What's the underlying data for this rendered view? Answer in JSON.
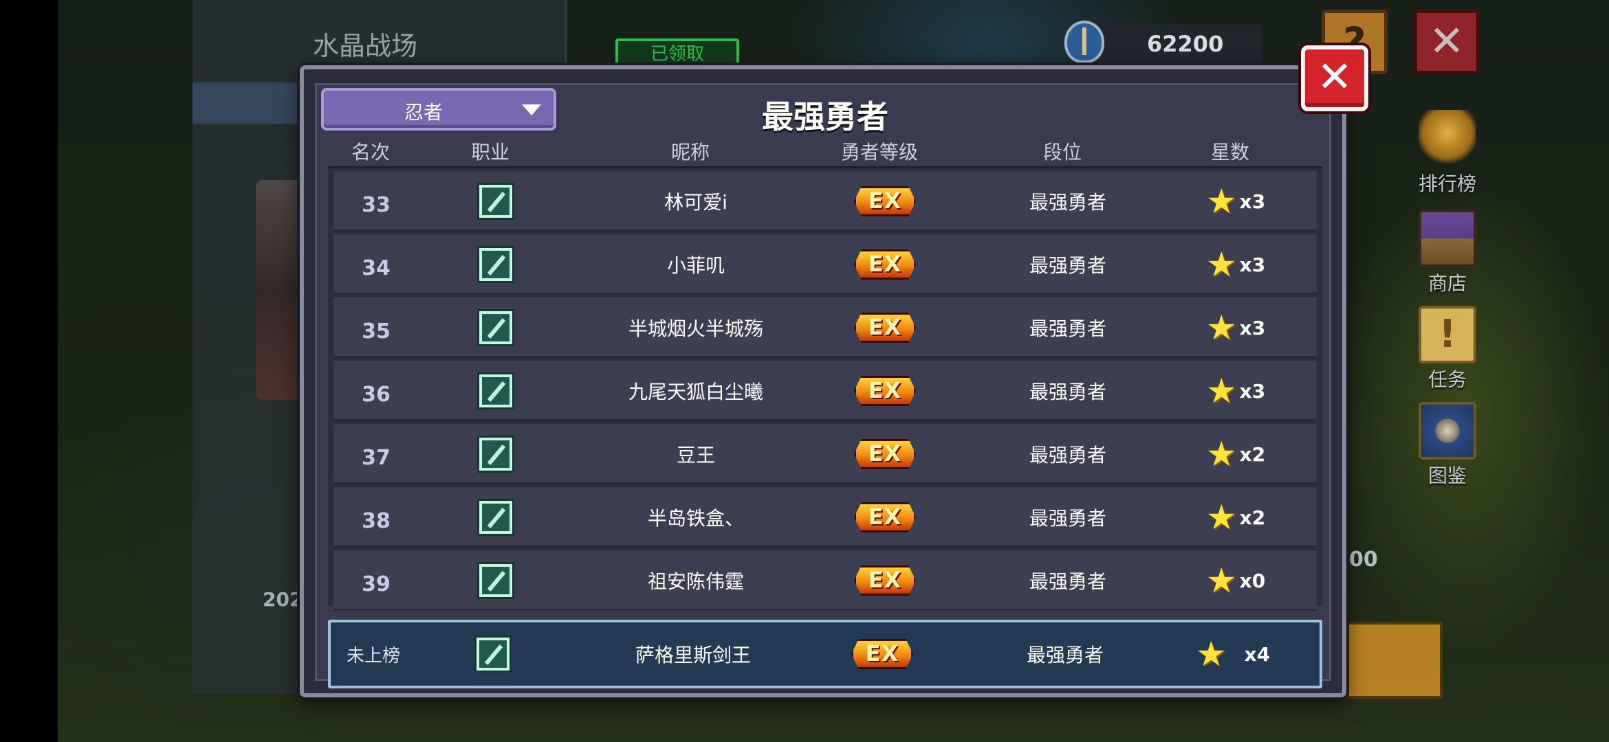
{
  "background": {
    "panel_title": "水晶战场",
    "claimed_label": "已领取",
    "year_text": "202",
    "partial_number": "00"
  },
  "currency": {
    "value": "62200",
    "icon": "shield-coin-icon"
  },
  "side_menu": [
    {
      "label": "排行榜",
      "icon": "trophy-icon"
    },
    {
      "label": "商店",
      "icon": "shop-icon"
    },
    {
      "label": "任务",
      "icon": "quest-scroll-icon"
    },
    {
      "label": "图鉴",
      "icon": "codex-book-icon"
    }
  ],
  "dialog": {
    "title": "最强勇者",
    "class_filter": "忍者",
    "headers": {
      "rank": "名次",
      "job": "职业",
      "nickname": "昵称",
      "hero_level": "勇者等级",
      "tier": "段位",
      "stars": "星数"
    },
    "rows": [
      {
        "rank": "33",
        "nickname": "林可爱i",
        "level": "EX",
        "tier": "最强勇者",
        "stars": "x3"
      },
      {
        "rank": "34",
        "nickname": "小菲叽",
        "level": "EX",
        "tier": "最强勇者",
        "stars": "x3"
      },
      {
        "rank": "35",
        "nickname": "半城烟火半城殇",
        "level": "EX",
        "tier": "最强勇者",
        "stars": "x3"
      },
      {
        "rank": "36",
        "nickname": "九尾天狐白尘曦",
        "level": "EX",
        "tier": "最强勇者",
        "stars": "x3"
      },
      {
        "rank": "37",
        "nickname": "豆王",
        "level": "EX",
        "tier": "最强勇者",
        "stars": "x2"
      },
      {
        "rank": "38",
        "nickname": "半岛铁盒、",
        "level": "EX",
        "tier": "最强勇者",
        "stars": "x2"
      },
      {
        "rank": "39",
        "nickname": "祖安陈伟霆",
        "level": "EX",
        "tier": "最强勇者",
        "stars": "x0"
      }
    ],
    "self_row": {
      "rank": "未上榜",
      "nickname": "萨格里斯剑王",
      "level": "EX",
      "tier": "最强勇者",
      "stars": "x4"
    }
  },
  "colors": {
    "dialog_bg": "#3a3a50",
    "row_bg": "#3e3e52",
    "self_row_bg": "#233a54",
    "close_red": "#d4242b",
    "star_yellow": "#ffe23a"
  }
}
